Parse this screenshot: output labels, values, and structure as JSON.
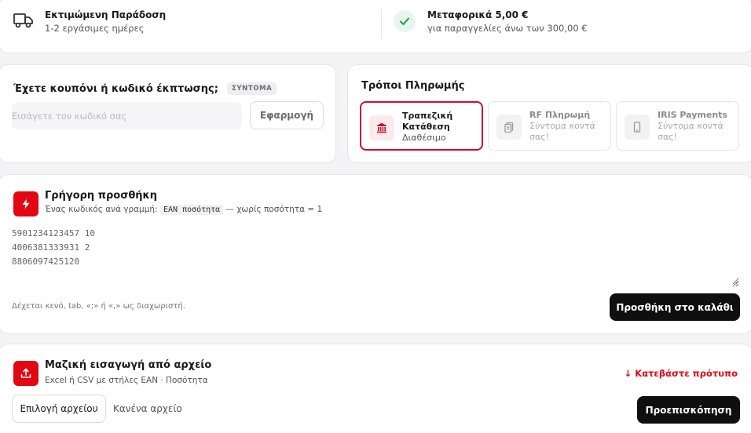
{
  "delivery": {
    "title": "Εκτιμώμενη Παράδοση",
    "subtitle": "1-2 εργάσιμες ημέρες",
    "icon": "truck-icon"
  },
  "shipping": {
    "title": "Μεταφορικά 5,00 €",
    "subtitle": "για παραγγελίες άνω των 300,00 €",
    "icon": "check-icon"
  },
  "coupon": {
    "title": "Έχετε κουπόνι ή κωδικό έκπτωσης;",
    "badge": "ΣΥΝΤΟΜΑ",
    "placeholder": "Εισάγετε τον κωδικό σας",
    "value": "",
    "apply_label": "Εφαρμογή"
  },
  "payment": {
    "title": "Τρόποι Πληρωμής",
    "options": [
      {
        "name": "Τραπεζική Κατάθεση",
        "status": "Διαθέσιμο",
        "icon": "bank-icon",
        "selected": true
      },
      {
        "name": "RF Πληρωμή",
        "status": "Σύντομα κοντά σας!",
        "icon": "receipt-icon",
        "selected": false
      },
      {
        "name": "IRIS Payments",
        "status": "Σύντομα κοντά σας!",
        "icon": "phone-icon",
        "selected": false
      }
    ]
  },
  "quick_add": {
    "title": "Γρήγορη προσθήκη",
    "hint_prefix": "Ένας κωδικός ανά γραμμή:",
    "hint_code": "EAN ποσότητα",
    "hint_suffix": "— χωρίς ποσότητα = 1",
    "codes": "5901234123457 10\n4006381333931 2\n8806097425120",
    "separator_hint": "Δέχεται κενό, tab, «;» ή «,» ως διαχωριστή.",
    "add_button": "Προσθήκη στο καλάθι",
    "icon": "lightning-icon"
  },
  "bulk_import": {
    "title": "Μαζική εισαγωγή από αρχείο",
    "subtitle": "Excel ή CSV με στήλες EAN · Ποσότητα",
    "download_label": "↓ Κατεβάστε πρότυπο",
    "choose_file": "Επιλογή αρχείου",
    "no_file": "Κανένα αρχείο",
    "preview_button": "Προεπισκόπηση",
    "icon": "upload-icon"
  },
  "colors": {
    "accent": "#e30613",
    "selected_border": "#c8102e",
    "success": "#1a9e4b",
    "dark_button": "#0f0f10"
  }
}
